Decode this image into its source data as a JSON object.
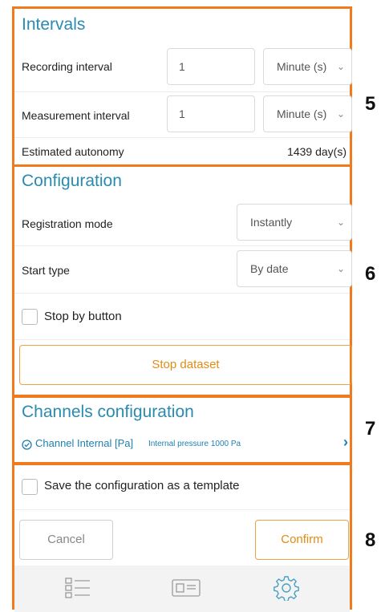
{
  "intervals": {
    "title": "Intervals",
    "recording": {
      "label": "Recording interval",
      "value": "1",
      "unit": "Minute (s)"
    },
    "measurement": {
      "label": "Measurement interval",
      "value": "1",
      "unit": "Minute (s)"
    },
    "autonomy": {
      "label": "Estimated autonomy",
      "value": "1439 day(s)"
    }
  },
  "configuration": {
    "title": "Configuration",
    "registration_mode": {
      "label": "Registration mode",
      "value": "Instantly"
    },
    "start_type": {
      "label": "Start type",
      "value": "By date"
    },
    "stop_by_button": {
      "label": "Stop by button",
      "checked": false
    },
    "stop_dataset_label": "Stop dataset"
  },
  "channels": {
    "title": "Channels configuration",
    "item": {
      "name": "Channel Internal [Pa]",
      "description": "Internal pressure 1000 Pa"
    }
  },
  "footer": {
    "template_label": "Save the configuration as a template",
    "cancel_label": "Cancel",
    "confirm_label": "Confirm"
  },
  "nav": {
    "items": [
      "list-icon",
      "card-icon",
      "settings-icon"
    ]
  },
  "markers": {
    "m5": "5",
    "m6": "6",
    "m7": "7",
    "m8": "8"
  },
  "colors": {
    "accent": "#f07a1c",
    "title_blue": "#2a8bb0",
    "confirm_orange": "#e38b12",
    "link_blue": "#1f7fae"
  }
}
